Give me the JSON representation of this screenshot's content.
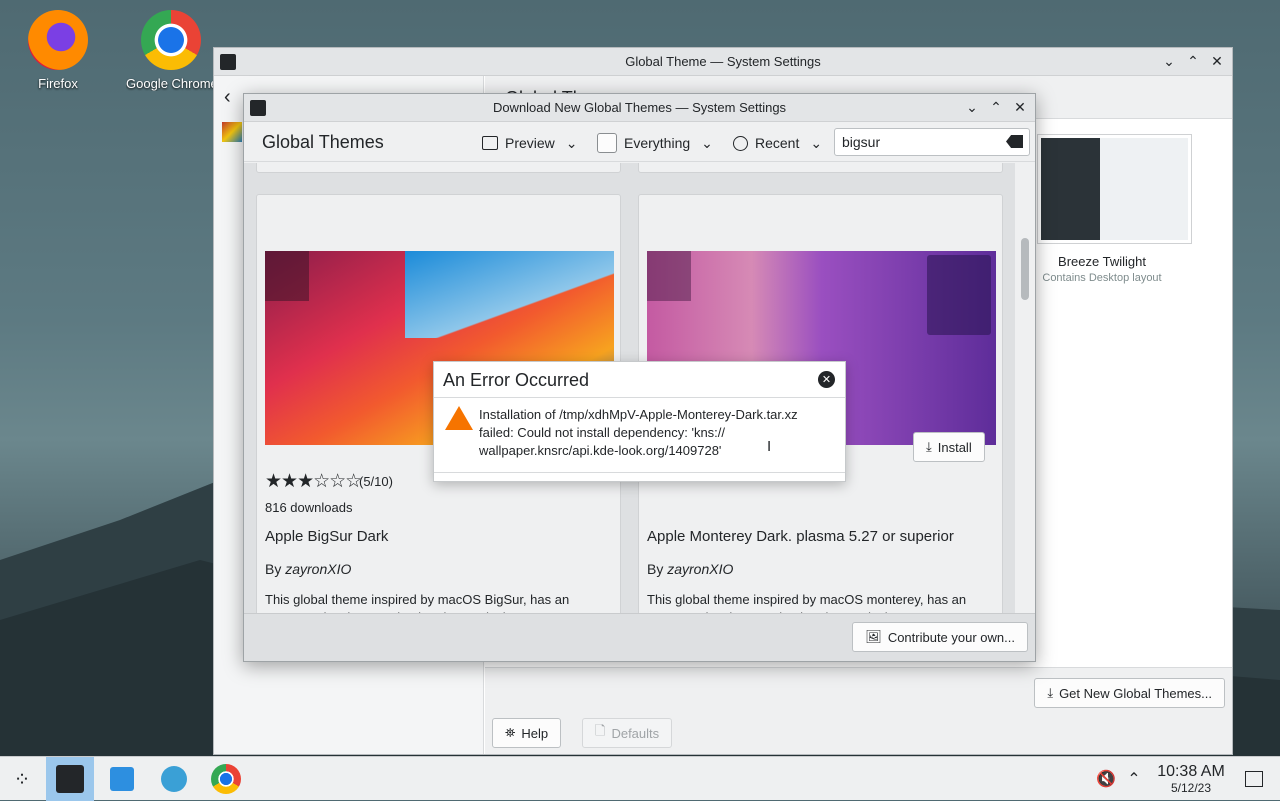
{
  "desktop": {
    "icons": [
      {
        "label": "Firefox"
      },
      {
        "label": "Google Chrome"
      }
    ]
  },
  "main_window": {
    "title": "Global Theme — System Settings",
    "partial_heading": "Global Th",
    "theme_card": {
      "name": "Breeze Twilight",
      "subtitle": "Contains Desktop layout"
    },
    "get_new_label": "Get New Global Themes...",
    "help_label": "Help",
    "defaults_label": "Defaults"
  },
  "dialog": {
    "title": "Download New Global Themes — System Settings",
    "heading": "Global Themes",
    "view_dropdown": "Preview",
    "filter_dropdown": "Everything",
    "sort_dropdown": "Recent",
    "search_value": "bigsur",
    "contribute_label": "Contribute your own...",
    "cards": [
      {
        "rating": "(5/10)",
        "downloads": "816 downloads",
        "name": "Apple BigSur Dark",
        "by_prefix": "By ",
        "author": "zayronXIO",
        "description": "This global theme inspired by macOS BigSur, has an automated script to make the plasma desktop appearance change completely, from the position of th..."
      },
      {
        "install_label": "Install",
        "name": "Apple Monterey Dark. plasma 5.27 or superior",
        "by_prefix": "By ",
        "author": "zayronXIO",
        "description": "This global theme inspired by macOS monterey, has an automated script to make the plasma desktop appearance change completely, from the position of th..."
      }
    ]
  },
  "error_dialog": {
    "title": "An Error Occurred",
    "message": "Installation of /tmp/xdhMpV-Apple-Monterey-Dark.tar.xz failed: Could not install dependency: 'kns:// wallpaper.knsrc/api.kde-look.org/1409728'"
  },
  "taskbar": {
    "time": "10:38 AM",
    "date": "5/12/23"
  }
}
